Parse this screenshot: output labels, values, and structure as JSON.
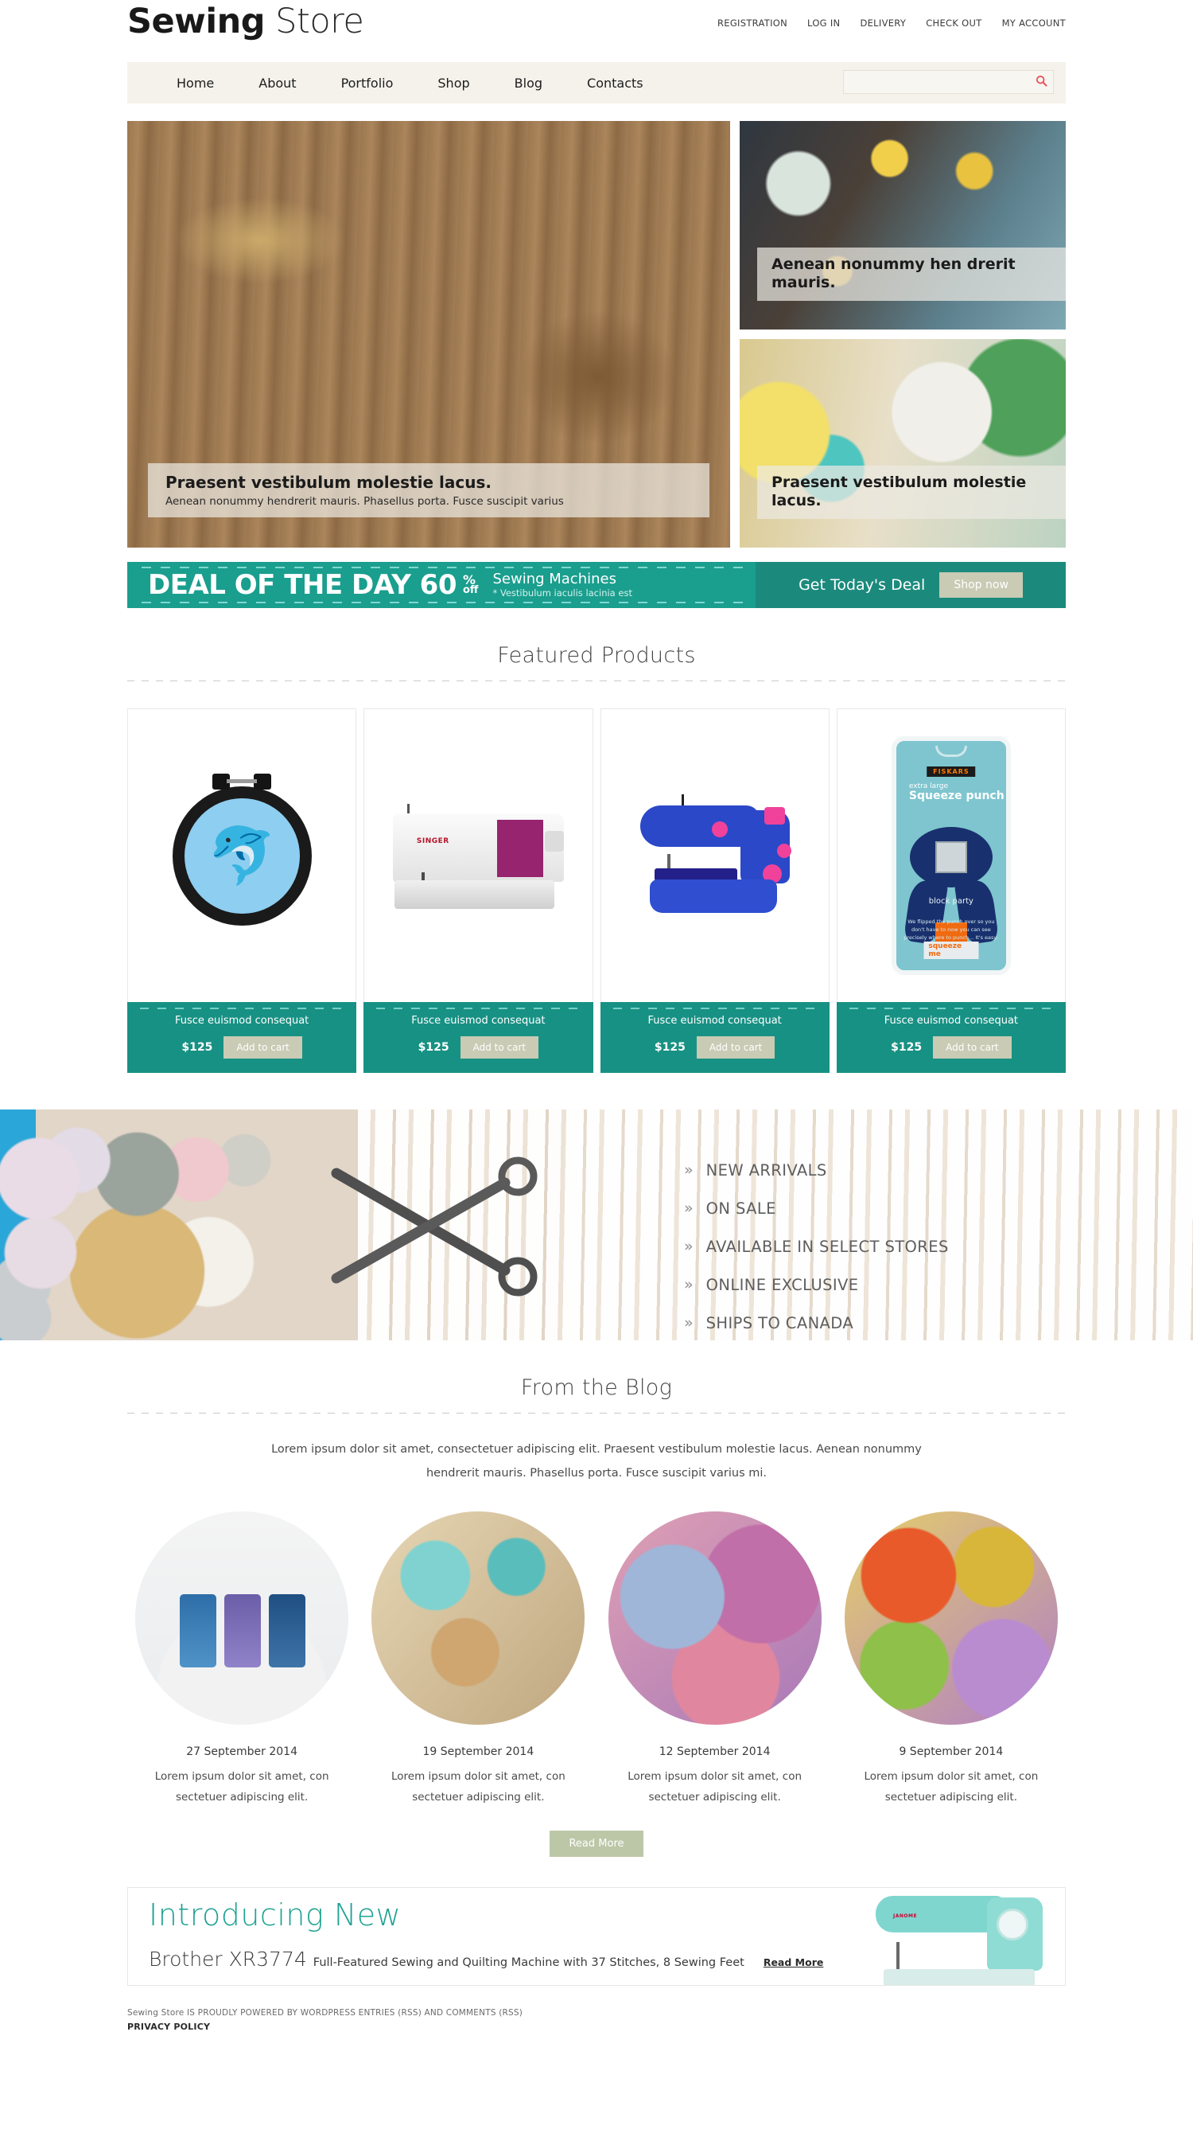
{
  "header": {
    "logo_bold": "Sewing",
    "logo_light": " Store",
    "top_links": [
      {
        "label": "REGISTRATION"
      },
      {
        "label": "LOG IN"
      },
      {
        "label": "DELIVERY"
      },
      {
        "label": "CHECK OUT"
      },
      {
        "label": "MY ACCOUNT"
      }
    ]
  },
  "nav": {
    "items": [
      {
        "label": "Home"
      },
      {
        "label": "About"
      },
      {
        "label": "Portfolio"
      },
      {
        "label": "Shop"
      },
      {
        "label": "Blog"
      },
      {
        "label": "Contacts"
      }
    ],
    "search": {
      "value": "",
      "placeholder": "",
      "icon": "search-icon"
    }
  },
  "slider": {
    "main": {
      "title": "Praesent vestibulum molestie lacus.",
      "subtitle": "Aenean nonummy hendrerit mauris. Phasellus porta. Fusce suscipit varius"
    },
    "side_top": {
      "title": "Aenean nonummy hen drerit mauris."
    },
    "side_bottom": {
      "title": "Praesent vestibulum molestie lacus."
    }
  },
  "deal": {
    "title": "DEAL OF THE DAY 60",
    "percent_symbol": "%",
    "off_label": "off",
    "product": "Sewing Machines",
    "note": "* Vestibulum iaculis lacinia est",
    "cta_text": "Get Today's Deal",
    "button_label": "Shop now"
  },
  "featured": {
    "section_title": "Featured Products",
    "products": [
      {
        "name": "Fusce euismod consequat",
        "price": "$125",
        "cart_label": "Add to cart",
        "art": "embroidery-hoop-dolphin"
      },
      {
        "name": "Fusce euismod consequat",
        "price": "$125",
        "cart_label": "Add to cart",
        "art": "singer-confidence-machine"
      },
      {
        "name": "Fusce euismod consequat",
        "price": "$125",
        "cart_label": "Add to cart",
        "art": "blue-mini-sewing-machine"
      },
      {
        "name": "Fusce euismod consequat",
        "price": "$125",
        "cart_label": "Add to cart",
        "art": "fiskars-squeeze-punch"
      }
    ],
    "product_art": {
      "singer_brand": "SINGER",
      "punch_brand": "FISKARS",
      "punch_t1": "extra large",
      "punch_t2": "Squeeze punch",
      "punch_t3": "block party",
      "punch_t4": "We flipped the punch over so you don't have to now you can see precisely where to punch... It's easy-try it",
      "punch_t5": "squeeze me"
    }
  },
  "categories": {
    "arrow_glyph": "»",
    "items": [
      {
        "label": "NEW ARRIVALS"
      },
      {
        "label": "ON SALE"
      },
      {
        "label": "AVAILABLE IN SELECT STORES"
      },
      {
        "label": "ONLINE EXCLUSIVE"
      },
      {
        "label": "SHIPS TO CANADA"
      }
    ]
  },
  "blog": {
    "section_title": "From the Blog",
    "intro": "Lorem ipsum dolor sit amet, consectetuer adipiscing elit. Praesent vestibulum molestie lacus. Aenean nonummy hendrerit mauris. Phasellus porta. Fusce suscipit varius mi.",
    "posts": [
      {
        "date": "27 September 2014",
        "excerpt": "Lorem ipsum dolor sit amet, con sectetuer adipiscing elit."
      },
      {
        "date": "19 September 2014",
        "excerpt": "Lorem ipsum dolor sit amet, con sectetuer adipiscing elit."
      },
      {
        "date": "12 September 2014",
        "excerpt": "Lorem ipsum dolor sit amet, con sectetuer adipiscing elit."
      },
      {
        "date": "9 September 2014",
        "excerpt": "Lorem ipsum dolor sit amet, con sectetuer adipiscing elit."
      }
    ],
    "read_more_label": "Read More"
  },
  "promo": {
    "heading": "Introducing New",
    "model": "Brother XR3774",
    "description": "Full-Featured Sewing and Quilting Machine with 37 Stitches, 8 Sewing Feet",
    "read_more_label": "Read More",
    "machine_brand": "JANOME"
  },
  "footer": {
    "credit": "Sewing Store IS PROUDLY POWERED BY WORDPRESS ENTRIES (RSS) AND COMMENTS (RSS)",
    "privacy": "PRIVACY POLICY"
  },
  "colors": {
    "teal": "#179184",
    "teal_dark": "#1b8a7c",
    "sage": "#c9cbb4",
    "nav_bg": "#f4f2eb",
    "accent_red": "#e8545a"
  }
}
